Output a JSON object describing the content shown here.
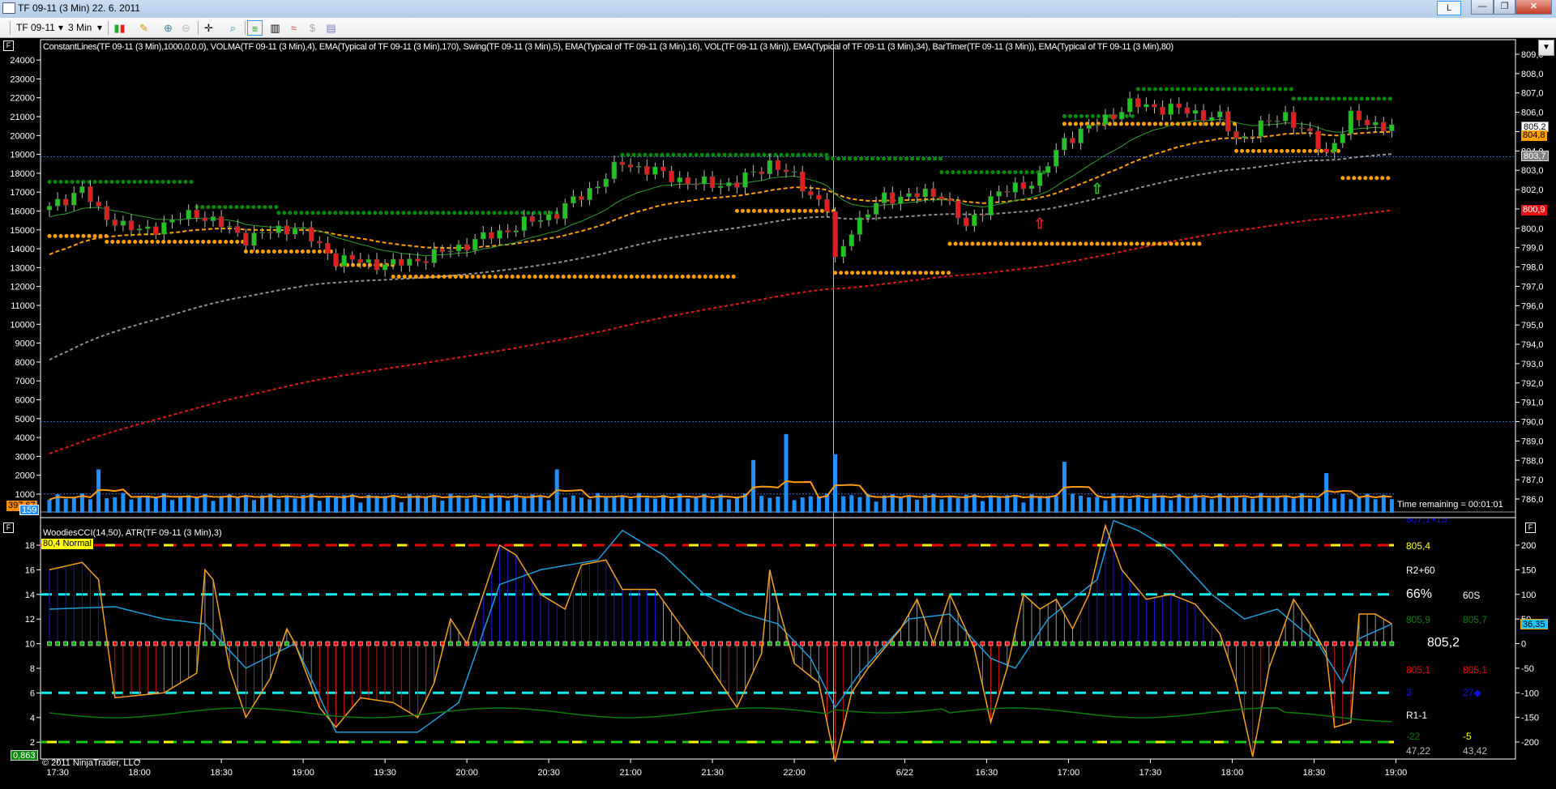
{
  "window": {
    "title": "TF 09-11 (3 Min)  22. 6. 2011",
    "lang_button": "L",
    "minimize": "—",
    "restore": "❐",
    "close": "✕"
  },
  "toolbar": {
    "instrument": "TF 09-11",
    "interval": "3 Min",
    "dropdown_glyph": "▾"
  },
  "upper_panel": {
    "indicators_label": "ConstantLines(TF 09-11 (3 Min),1000,0,0,0), VOLMA(TF 09-11 (3 Min),4), EMA(Typical of TF 09-11 (3 Min),170), Swing(TF 09-11 (3 Min),5), EMA(Typical of TF 09-11 (3 Min),16), VOL(TF 09-11 (3 Min)), EMA(Typical of TF 09-11 (3 Min),34), BarTimer(TF 09-11 (3 Min)), EMA(Typical of TF 09-11 (3 Min),80)",
    "panel_button": "F",
    "time_remaining": "Time remaining = 00:01:01",
    "price_axis": [
      "809,0",
      "808,0",
      "807,0",
      "806,0",
      "805,0",
      "804,0",
      "803,0",
      "802,0",
      "801,0",
      "800,0",
      "799,0",
      "798,0",
      "797,0",
      "796,0",
      "795,0",
      "794,0",
      "793,0",
      "792,0",
      "791,0",
      "790,0",
      "789,0",
      "788,0",
      "787,0",
      "786,0"
    ],
    "volume_axis": [
      "24000",
      "23000",
      "22000",
      "21000",
      "20000",
      "19000",
      "18000",
      "17000",
      "16000",
      "15000",
      "14000",
      "13000",
      "12000",
      "11000",
      "10000",
      "9000",
      "8000",
      "7000",
      "6000",
      "5000",
      "4000",
      "3000",
      "2000",
      "1000"
    ],
    "tags": {
      "last": "805,2",
      "ema16": "804,8",
      "ema80": "803,7",
      "ema170": "800,9",
      "volma": "397,67",
      "volume": "159"
    },
    "colors": {
      "up": "#22c422",
      "down": "#e02020",
      "ema16": "#2e9d2e",
      "ema34": "#ffa000",
      "ema80": "#909090",
      "ema170": "#e01818",
      "swing_high": "#008a00",
      "swing_low": "#ffa000",
      "volume": "#1e90ff",
      "volma": "#ff9a10"
    }
  },
  "lower_panel": {
    "indicators_label": "WoodiesCCI(14,50), ATR(TF 09-11 (3 Min),3)",
    "panel_button": "F",
    "atr_badge": "80,4 Normal",
    "copyright": "© 2011 NinjaTrader, LLC",
    "left_axis": [
      "18",
      "16",
      "14",
      "12",
      "10",
      "8",
      "6",
      "4",
      "2"
    ],
    "right_axis": [
      "200",
      "150",
      "100",
      "50",
      "0",
      "-50",
      "-100",
      "-150",
      "-200"
    ],
    "tags": {
      "cci": "36,35",
      "atr": "0,863"
    },
    "info": {
      "top": "807,1+15",
      "r2": "805,4",
      "r2_label": "R2+60",
      "pct": "66%",
      "secs": "60S",
      "g1": "805,9",
      "g2": "805,7",
      "last": "805,2",
      "r1": "805,1",
      "r2b": "805,1",
      "b1": "3",
      "b2": "27◆",
      "r1_label": "R1-1",
      "n1": "-22",
      "n2": "-5",
      "c1": "47,22",
      "c2": "43,42"
    }
  },
  "x_axis": [
    {
      "t": "17:30",
      "bar": 1
    },
    {
      "t": "18:00",
      "bar": 11
    },
    {
      "t": "18:30",
      "bar": 21
    },
    {
      "t": "19:00",
      "bar": 31
    },
    {
      "t": "19:30",
      "bar": 41
    },
    {
      "t": "20:00",
      "bar": 51
    },
    {
      "t": "20:30",
      "bar": 61
    },
    {
      "t": "21:00",
      "bar": 71
    },
    {
      "t": "21:30",
      "bar": 81
    },
    {
      "t": "22:00",
      "bar": 91
    },
    {
      "t": "6/22",
      "bar": 104.5
    },
    {
      "t": "16:30",
      "bar": 114.5
    },
    {
      "t": "17:00",
      "bar": 124.5
    },
    {
      "t": "17:30",
      "bar": 134.5
    },
    {
      "t": "18:00",
      "bar": 144.5
    },
    {
      "t": "18:30",
      "bar": 154.5
    },
    {
      "t": "19:00",
      "bar": 164.5
    }
  ],
  "chart_data": {
    "type": "candlestick",
    "bars": 165,
    "price_path": [
      [
        0,
        801.0
      ],
      [
        4,
        802.1
      ],
      [
        6,
        800.8
      ],
      [
        11,
        799.8
      ],
      [
        18,
        800.8
      ],
      [
        24,
        799.5
      ],
      [
        30,
        800.1
      ],
      [
        35,
        798.4
      ],
      [
        42,
        798.1
      ],
      [
        47,
        798.6
      ],
      [
        55,
        799.8
      ],
      [
        62,
        800.8
      ],
      [
        67,
        802.3
      ],
      [
        70,
        803.4
      ],
      [
        79,
        802.3
      ],
      [
        84,
        802.3
      ],
      [
        88,
        803.4
      ],
      [
        91,
        802.6
      ],
      [
        95,
        801.0
      ],
      [
        96,
        798.2
      ],
      [
        98,
        800.0
      ],
      [
        102,
        801.6
      ],
      [
        109,
        801.8
      ],
      [
        112,
        800.0
      ],
      [
        115,
        801.6
      ],
      [
        121,
        802.6
      ],
      [
        124,
        804.6
      ],
      [
        127,
        805.2
      ],
      [
        132,
        806.4
      ],
      [
        137,
        806.2
      ],
      [
        143,
        805.7
      ],
      [
        145,
        804.6
      ],
      [
        151,
        805.9
      ],
      [
        156,
        803.9
      ],
      [
        159,
        805.7
      ],
      [
        164,
        805.2
      ]
    ],
    "ema_seeds": {
      "ema16": 800.5,
      "ema34": 798.5,
      "ema80": 793.0,
      "ema170": 788.2
    },
    "swing_highs": [
      [
        0,
        18,
        802.4
      ],
      [
        18,
        28,
        801.1
      ],
      [
        28,
        62,
        800.8
      ],
      [
        70,
        95,
        803.8
      ],
      [
        95,
        109,
        803.6
      ],
      [
        109,
        122,
        802.9
      ],
      [
        124,
        133,
        805.8
      ],
      [
        133,
        152,
        807.2
      ],
      [
        152,
        164,
        806.7
      ]
    ],
    "swing_lows": [
      [
        0,
        7,
        799.6
      ],
      [
        7,
        24,
        799.3
      ],
      [
        24,
        35,
        798.8
      ],
      [
        35,
        42,
        798.1
      ],
      [
        42,
        84,
        797.5
      ],
      [
        84,
        96,
        800.9
      ],
      [
        96,
        110,
        797.7
      ],
      [
        110,
        141,
        799.2
      ],
      [
        124,
        145,
        805.4
      ],
      [
        145,
        158,
        804.0
      ],
      [
        158,
        164,
        802.6
      ]
    ],
    "arrows": [
      {
        "bar": 121,
        "price": 800.0,
        "dir": "up",
        "color": "#e02020"
      },
      {
        "bar": 128,
        "price": 801.8,
        "dir": "up",
        "color": "#22c422"
      }
    ],
    "h_lines": [
      803.7,
      790.0
    ],
    "volume_spikes": [
      [
        6,
        2300
      ],
      [
        62,
        2300
      ],
      [
        86,
        2800
      ],
      [
        90,
        4170
      ],
      [
        96,
        3100
      ],
      [
        124,
        2700
      ],
      [
        156,
        2100
      ]
    ],
    "cci": [
      [
        0,
        150
      ],
      [
        4,
        165
      ],
      [
        6,
        130
      ],
      [
        8,
        -110
      ],
      [
        14,
        -100
      ],
      [
        18,
        -60
      ],
      [
        19,
        150
      ],
      [
        20,
        130
      ],
      [
        22,
        -50
      ],
      [
        24,
        -150
      ],
      [
        27,
        -70
      ],
      [
        29,
        30
      ],
      [
        30,
        0
      ],
      [
        33,
        -130
      ],
      [
        35,
        -170
      ],
      [
        38,
        -110
      ],
      [
        42,
        -120
      ],
      [
        45,
        -150
      ],
      [
        47,
        -80
      ],
      [
        49,
        50
      ],
      [
        51,
        0
      ],
      [
        55,
        200
      ],
      [
        57,
        180
      ],
      [
        60,
        100
      ],
      [
        63,
        70
      ],
      [
        65,
        160
      ],
      [
        68,
        170
      ],
      [
        70,
        110
      ],
      [
        74,
        110
      ],
      [
        77,
        40
      ],
      [
        80,
        -30
      ],
      [
        84,
        -130
      ],
      [
        87,
        -20
      ],
      [
        88,
        150
      ],
      [
        89,
        80
      ],
      [
        91,
        -40
      ],
      [
        94,
        -80
      ],
      [
        96,
        -240
      ],
      [
        98,
        -100
      ],
      [
        100,
        -50
      ],
      [
        104,
        30
      ],
      [
        106,
        90
      ],
      [
        108,
        0
      ],
      [
        110,
        100
      ],
      [
        113,
        -10
      ],
      [
        115,
        -160
      ],
      [
        117,
        -50
      ],
      [
        119,
        100
      ],
      [
        121,
        70
      ],
      [
        123,
        90
      ],
      [
        125,
        30
      ],
      [
        127,
        100
      ],
      [
        129,
        240
      ],
      [
        131,
        150
      ],
      [
        134,
        90
      ],
      [
        137,
        100
      ],
      [
        140,
        80
      ],
      [
        143,
        20
      ],
      [
        145,
        -80
      ],
      [
        147,
        -230
      ],
      [
        149,
        -50
      ],
      [
        152,
        90
      ],
      [
        154,
        40
      ],
      [
        156,
        -20
      ],
      [
        157,
        -170
      ],
      [
        159,
        -160
      ],
      [
        160,
        60
      ],
      [
        162,
        60
      ],
      [
        164,
        40
      ]
    ],
    "turbo_cci": [
      [
        0,
        70
      ],
      [
        8,
        75
      ],
      [
        14,
        50
      ],
      [
        19,
        40
      ],
      [
        24,
        -50
      ],
      [
        30,
        0
      ],
      [
        35,
        -180
      ],
      [
        45,
        -180
      ],
      [
        50,
        -120
      ],
      [
        55,
        120
      ],
      [
        60,
        150
      ],
      [
        67,
        170
      ],
      [
        70,
        230
      ],
      [
        75,
        180
      ],
      [
        80,
        100
      ],
      [
        85,
        60
      ],
      [
        89,
        40
      ],
      [
        93,
        -30
      ],
      [
        96,
        -130
      ],
      [
        99,
        -60
      ],
      [
        105,
        50
      ],
      [
        110,
        60
      ],
      [
        115,
        -30
      ],
      [
        118,
        -50
      ],
      [
        122,
        50
      ],
      [
        128,
        130
      ],
      [
        130,
        250
      ],
      [
        133,
        230
      ],
      [
        137,
        190
      ],
      [
        142,
        100
      ],
      [
        146,
        50
      ],
      [
        150,
        70
      ],
      [
        155,
        0
      ],
      [
        158,
        -80
      ],
      [
        160,
        10
      ],
      [
        164,
        40
      ]
    ]
  }
}
